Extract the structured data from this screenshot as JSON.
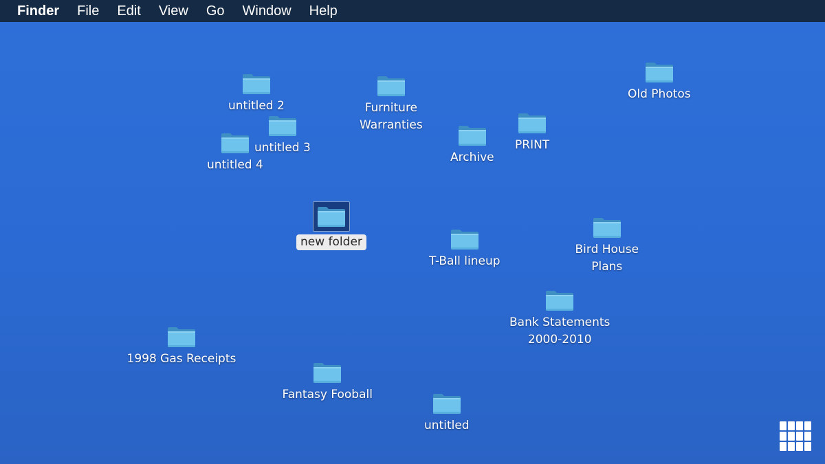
{
  "menubar": {
    "items": [
      "Finder",
      "File",
      "Edit",
      "View",
      "Go",
      "Window",
      "Help"
    ]
  },
  "colors": {
    "desktop": "#2e6fd8",
    "menubar": "#152a44",
    "folder_front": "#6ec3ec",
    "folder_back": "#3d8fc4"
  },
  "desktop": {
    "icons": [
      {
        "label": "untitled 2",
        "icon": "folder-icon"
      },
      {
        "label": "untitled 3",
        "icon": "folder-icon"
      },
      {
        "label": "untitled 4",
        "icon": "folder-icon"
      },
      {
        "label": "Furniture\nWarranties",
        "icon": "folder-icon"
      },
      {
        "label": "Archive",
        "icon": "folder-icon"
      },
      {
        "label": "PRINT",
        "icon": "folder-icon"
      },
      {
        "label": "Old Photos",
        "icon": "folder-icon"
      },
      {
        "label": "new folder",
        "icon": "folder-icon",
        "selected": true
      },
      {
        "label": "T-Ball lineup",
        "icon": "folder-icon"
      },
      {
        "label": "Bird House\nPlans",
        "icon": "folder-icon"
      },
      {
        "label": "Bank Statements\n2000-2010",
        "icon": "folder-icon"
      },
      {
        "label": "1998 Gas Receipts",
        "icon": "folder-icon"
      },
      {
        "label": "Fantasy Fooball",
        "icon": "folder-icon"
      },
      {
        "label": "untitled",
        "icon": "folder-icon"
      }
    ]
  },
  "launcher": {
    "icon": "app-grid-icon"
  }
}
